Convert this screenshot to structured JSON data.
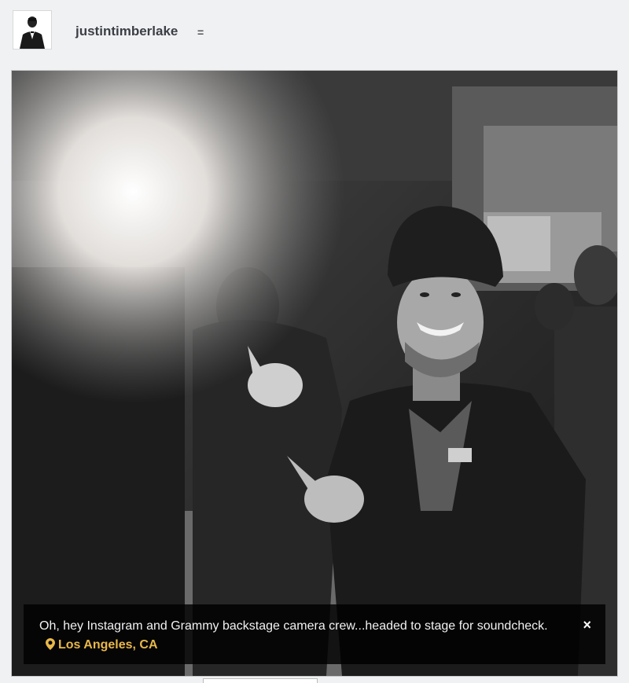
{
  "profile": {
    "username": "justintimberlake",
    "avatar_icon": "profile-photo",
    "menu_glyph": "="
  },
  "photo": {
    "description_icon": "backstage-photo"
  },
  "caption": {
    "text": "Oh, hey Instagram and Grammy backstage camera crew...headed to stage for soundcheck.",
    "location": "Los Angeles, CA",
    "close_glyph": "×"
  },
  "colors": {
    "location": "#e8b84a",
    "caption_bg": "#000000"
  }
}
